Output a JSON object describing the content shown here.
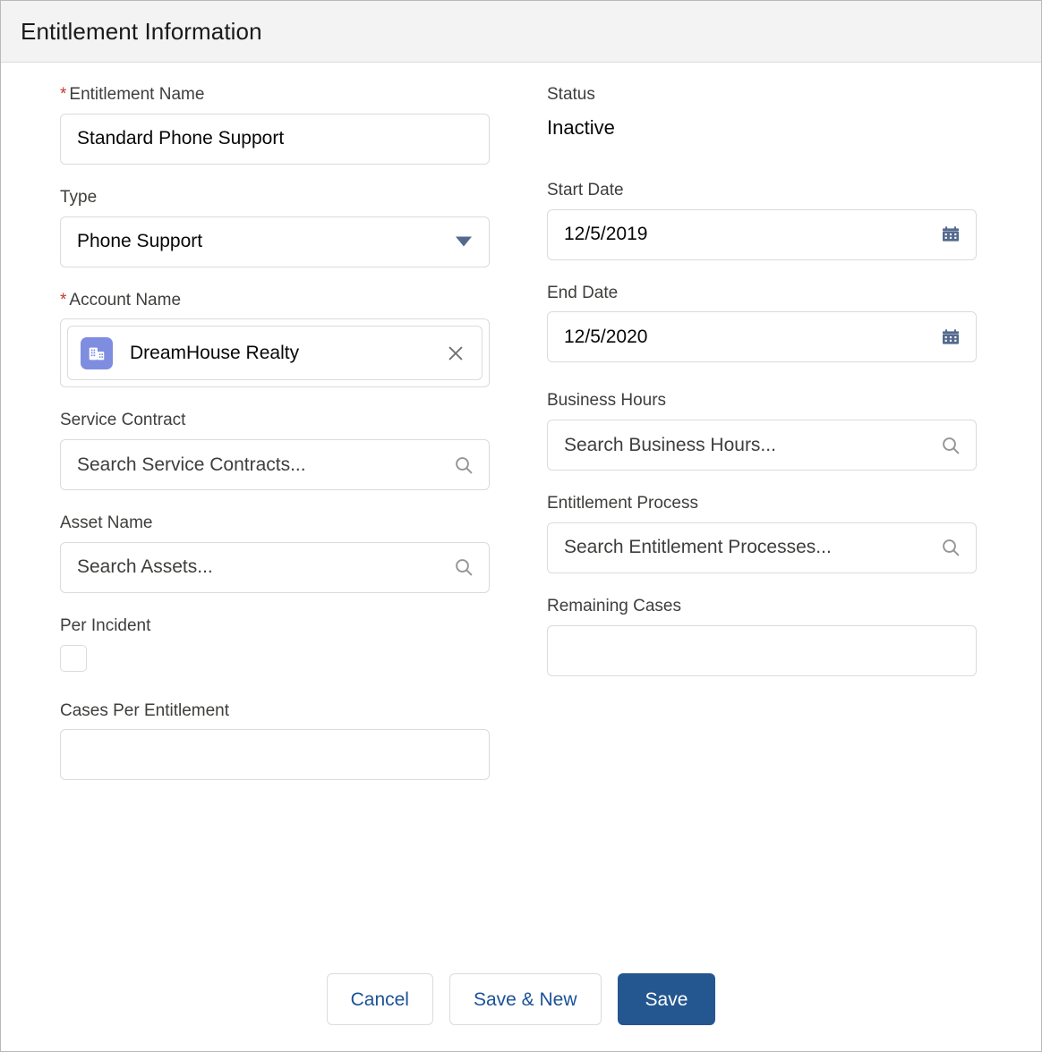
{
  "header": {
    "title": "Entitlement Information"
  },
  "colors": {
    "header_bg": "#f3f3f3",
    "required_asterisk": "#c23934",
    "brand_blue": "#24578f",
    "link_blue": "#1b5297",
    "account_icon_bg": "#7f8de1",
    "picklist_arrow": "#54698d",
    "calendar_icon": "#54698d",
    "border": "#dddbda"
  },
  "left_column": {
    "entitlement_name": {
      "label": "Entitlement Name",
      "required": true,
      "required_marker": "*",
      "value": "Standard Phone Support",
      "placeholder": ""
    },
    "type": {
      "label": "Type",
      "required": false,
      "value": "Phone Support",
      "icon": "chevron-down-icon"
    },
    "account_name": {
      "label": "Account Name",
      "required": true,
      "required_marker": "*",
      "value": "DreamHouse Realty",
      "record_icon": "account-building-icon",
      "remove_icon": "close-icon"
    },
    "service_contract": {
      "label": "Service Contract",
      "required": false,
      "value": "",
      "placeholder": "Search Service Contracts...",
      "icon": "search-icon"
    },
    "asset_name": {
      "label": "Asset Name",
      "required": false,
      "value": "",
      "placeholder": "Search Assets...",
      "icon": "search-icon"
    },
    "per_incident": {
      "label": "Per Incident",
      "required": false,
      "checked": false
    },
    "cases_per_entitlement": {
      "label": "Cases Per Entitlement",
      "required": false,
      "value": "",
      "placeholder": ""
    }
  },
  "right_column": {
    "status": {
      "label": "Status",
      "value": "Inactive"
    },
    "start_date": {
      "label": "Start Date",
      "required": false,
      "value": "12/5/2019",
      "placeholder": "",
      "icon": "calendar-icon"
    },
    "end_date": {
      "label": "End Date",
      "required": false,
      "value": "12/5/2020",
      "placeholder": "",
      "icon": "calendar-icon"
    },
    "business_hours": {
      "label": "Business Hours",
      "required": false,
      "value": "",
      "placeholder": "Search Business Hours...",
      "icon": "search-icon"
    },
    "entitlement_process": {
      "label": "Entitlement Process",
      "required": false,
      "value": "",
      "placeholder": "Search Entitlement Processes...",
      "icon": "search-icon"
    },
    "remaining_cases": {
      "label": "Remaining Cases",
      "required": false,
      "value": "",
      "placeholder": ""
    }
  },
  "footer": {
    "cancel_label": "Cancel",
    "save_new_label": "Save & New",
    "save_label": "Save"
  }
}
